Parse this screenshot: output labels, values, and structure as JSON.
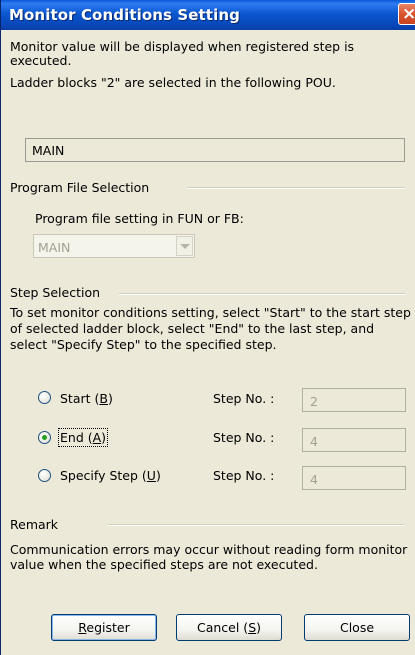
{
  "window": {
    "title": "Monitor Conditions Setting",
    "close_glyph": "×"
  },
  "intro": {
    "line1": "Monitor value will be displayed when registered step is executed.",
    "line2": "Ladder blocks \"2\" are selected in the following POU."
  },
  "pou_field": {
    "value": "MAIN"
  },
  "program_file": {
    "group_label": "Program File Selection",
    "setting_label": "Program file setting in FUN or FB:",
    "combo_value": "MAIN"
  },
  "step_selection": {
    "group_label": "Step Selection",
    "description": "To set monitor conditions setting, select \"Start\" to the start step of selected ladder block, select \"End\" to the last step, and select \"Specify Step\" to the specified step.",
    "options": [
      {
        "label_pre": "Start (",
        "mnemonic": "B",
        "label_post": ")",
        "selected": false,
        "step_label": "Step No. :",
        "step_value": "2"
      },
      {
        "label_pre": "End (",
        "mnemonic": "A",
        "label_post": ")",
        "selected": true,
        "step_label": "Step No. :",
        "step_value": "4"
      },
      {
        "label_pre": "Specify Step (",
        "mnemonic": "U",
        "label_post": ")",
        "selected": false,
        "step_label": "Step No. :",
        "step_value": "4"
      }
    ]
  },
  "remark": {
    "group_label": "Remark",
    "text": "Communication errors may occur without reading form monitor value when the specified steps are not executed."
  },
  "buttons": {
    "register": {
      "pre": "",
      "mnemonic": "R",
      "post": "egister"
    },
    "cancel": {
      "pre": "Cancel (",
      "mnemonic": "S",
      "post": ")"
    },
    "close": {
      "label": "Close"
    }
  },
  "colors": {
    "titlebar": "#0A58D8",
    "dialog_bg": "#ECE9D8",
    "radio_selected": "#21A121"
  }
}
